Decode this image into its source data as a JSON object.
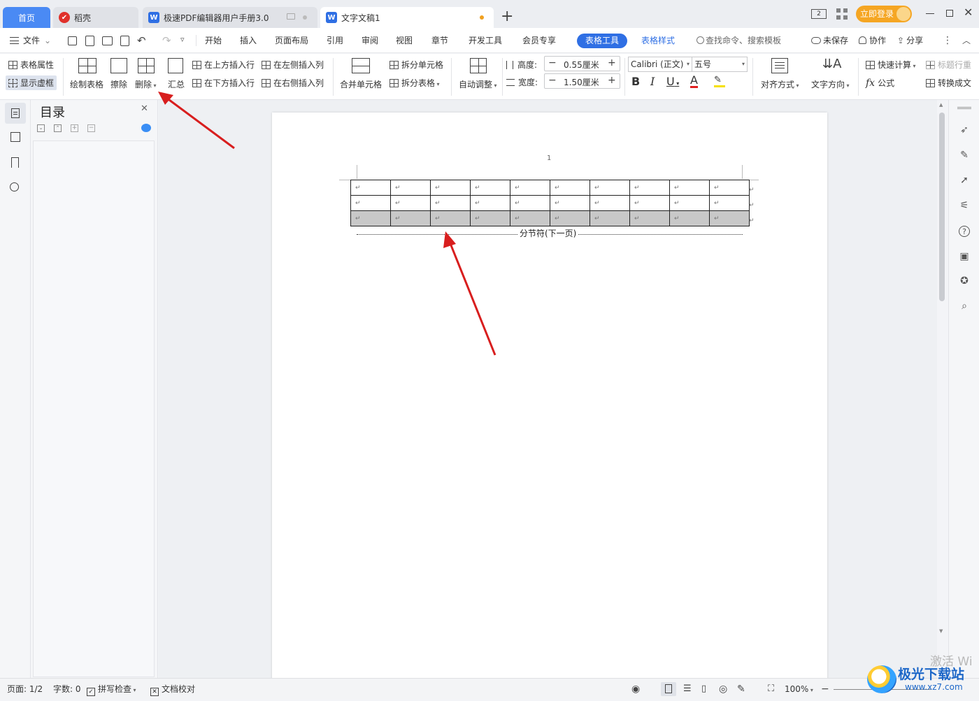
{
  "tabs": {
    "home": "首页",
    "daoke": "稻壳",
    "pdf_manual": "极速PDF编辑器用户手册3.0",
    "doc": "文字文稿1",
    "add": "+"
  },
  "window": {
    "login": "立即登录"
  },
  "menu": {
    "file": "文件",
    "items": [
      "开始",
      "插入",
      "页面布局",
      "引用",
      "审阅",
      "视图",
      "章节",
      "开发工具",
      "会员专享"
    ],
    "table_tools": "表格工具",
    "table_style": "表格样式",
    "search": "查找命令、搜索模板",
    "unsaved": "未保存",
    "collab": "协作",
    "share": "分享"
  },
  "ribbon": {
    "table_props": "表格属性",
    "show_grid": "显示虚框",
    "draw_table": "绘制表格",
    "erase": "擦除",
    "delete": "删除",
    "summary": "汇总",
    "insert_above": "在上方插入行",
    "insert_below": "在下方插入行",
    "insert_left": "在左侧插入列",
    "insert_right": "在右侧插入列",
    "merge_cells": "合并单元格",
    "split_cells": "拆分单元格",
    "split_table": "拆分表格",
    "auto_adjust": "自动调整",
    "height_label": "高度:",
    "height_value": "0.55厘米",
    "width_label": "宽度:",
    "width_value": "1.50厘米",
    "font_name": "Calibri (正文)",
    "font_size": "五号",
    "align": "对齐方式",
    "text_dir": "文字方向",
    "quick_calc": "快速计算",
    "title_row": "标题行重",
    "formula": "公式",
    "convert": "转换成文"
  },
  "toc": {
    "title": "目录"
  },
  "document": {
    "page_number": "1",
    "cell_mark": "↵",
    "section_break": "分节符(下一页)",
    "table_rows": 3,
    "table_cols": 10,
    "selected_row": 3
  },
  "status": {
    "page": "页面: 1/2",
    "words": "字数: 0",
    "spell": "拼写检查",
    "proof": "文档校对",
    "zoom": "100%"
  },
  "watermark": {
    "activate": "激活 Wi",
    "site": "极光下载站",
    "url": "www.xz7.com"
  },
  "colors": {
    "accent": "#2f6fe4",
    "login": "#f5a623",
    "arrow": "#d81e1e"
  }
}
